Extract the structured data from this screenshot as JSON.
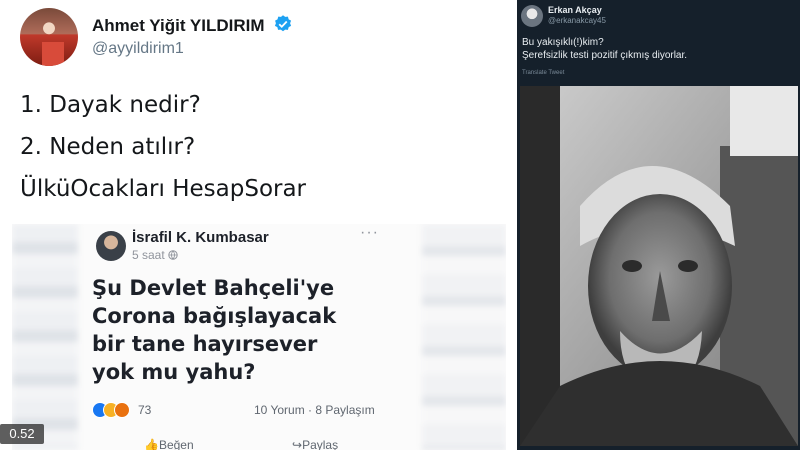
{
  "left_tweet": {
    "author_name": "Ahmet Yiğit YILDIRIM",
    "handle": "@ayyildirim1",
    "lines": [
      "1. Dayak nedir?",
      "2. Neden atılır?",
      "ÜlküOcakları HesapSorar"
    ],
    "embedded_post": {
      "author": "İsrafil K. Kumbasar",
      "time": "5 saat",
      "more": "···",
      "text_lines": [
        "Şu Devlet Bahçeli'ye",
        "Corona bağışlayacak",
        "bir tane hayırsever",
        "yok mu yahu?"
      ],
      "reaction_count": "73",
      "stats": "10 Yorum · 8 Paylaşım",
      "actions": [
        "Beğen",
        "Paylaş"
      ]
    },
    "video_timer": "0.52"
  },
  "right_tweet": {
    "author_name": "Erkan Akçay",
    "handle": "@erkanakcay45",
    "text_lines": [
      "Bu yakışıklı(!)kim?",
      "Şerefsizlik testi pozitif çıkmış diyorlar."
    ],
    "translate_label": "Translate Tweet"
  },
  "colors": {
    "verified_blue": "#1da1f2",
    "twitter_dark_bg": "#15202b",
    "like_blue": "#1877f2",
    "haha_yellow": "#f7b125",
    "angry_orange": "#e9710f"
  }
}
